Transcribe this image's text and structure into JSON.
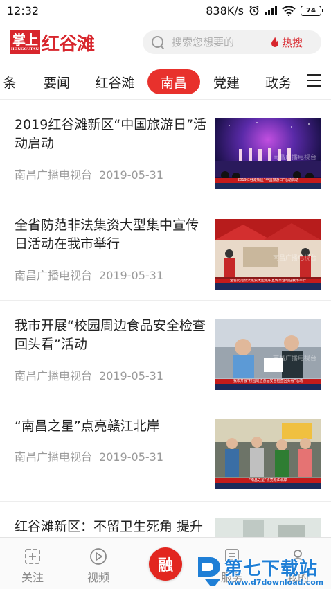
{
  "status_bar": {
    "time": "12:32",
    "network_speed": "838K/s",
    "battery_level": "74"
  },
  "header": {
    "logo_badge_big": "掌上",
    "logo_badge_small": "HONGGUTAN",
    "logo_text": "红谷滩",
    "search_placeholder": "搜索您想要的",
    "hot_label": "热搜",
    "brand_color": "#d8262d"
  },
  "channels": {
    "items": [
      {
        "label": "条"
      },
      {
        "label": "要闻"
      },
      {
        "label": "红谷滩"
      },
      {
        "label": "南昌"
      },
      {
        "label": "党建"
      },
      {
        "label": "政务"
      }
    ],
    "active_label": "南昌",
    "active_color": "#e8312c"
  },
  "news": [
    {
      "title": "2019红谷滩新区“中国旅游日”活动启动",
      "source": "南昌广播电视台",
      "date": "2019-05-31",
      "thumb_caption": "2019红谷滩新区“中国旅游日”活动启动",
      "thumb_watermark": "南昌广播电视台"
    },
    {
      "title": "全省防范非法集资大型集中宣传日活动在我市举行",
      "source": "南昌广播电视台",
      "date": "2019-05-31",
      "thumb_caption": "全省防范非法集资大型集中宣传日活动在我市举行",
      "thumb_watermark": "南昌广播电视台"
    },
    {
      "title": "我市开展“校园周边食品安全检查回头看”活动",
      "source": "南昌广播电视台",
      "date": "2019-05-31",
      "thumb_caption": "我市开展“校园周边食品安全检查回头看”活动",
      "thumb_watermark": "南昌广播电视台"
    },
    {
      "title": "“南昌之星”点亮赣江北岸",
      "source": "南昌广播电视台",
      "date": "2019-05-31",
      "thumb_caption": "“南昌之星”点亮赣江北岸",
      "thumb_watermark": ""
    },
    {
      "title": "红谷滩新区：不留卫生死角 提升",
      "source": "",
      "date": "",
      "thumb_caption": "",
      "thumb_watermark": ""
    }
  ],
  "bottom_nav": {
    "follow_label": "关注",
    "video_label": "视频",
    "center_label": "融",
    "service_label": "服务",
    "mine_label": "我的"
  },
  "watermark": {
    "title": "第七下载站",
    "url": "www.d7download.com"
  }
}
